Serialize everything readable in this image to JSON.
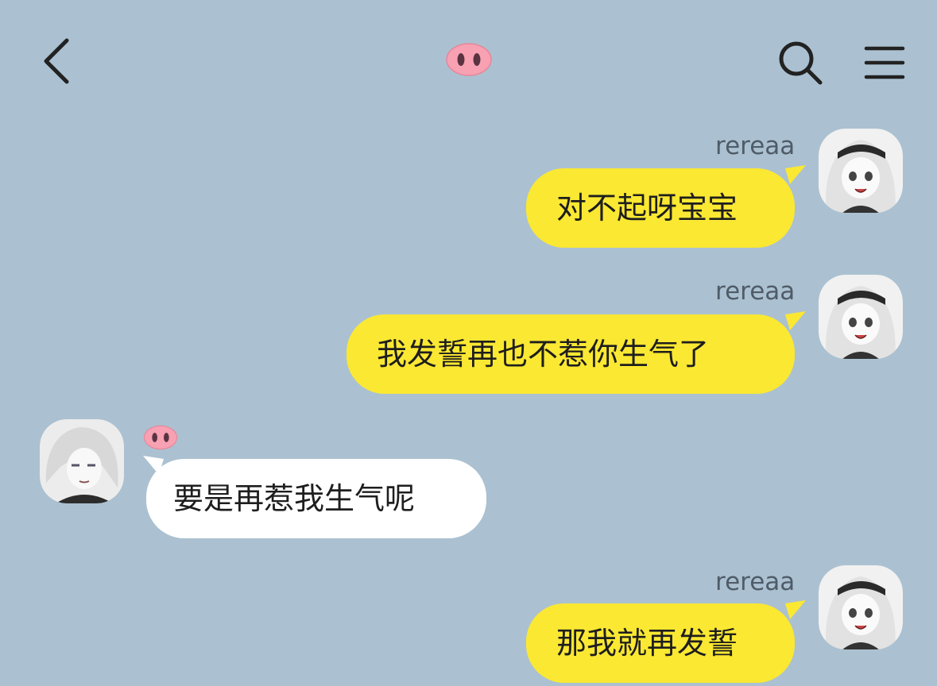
{
  "header": {
    "title_icon": "pig-nose-icon",
    "back_icon": "chevron-left-icon",
    "search_icon": "search-icon",
    "menu_icon": "hamburger-menu-icon"
  },
  "colors": {
    "background": "#abc1d1",
    "my_bubble": "#fbe832",
    "their_bubble": "#ffffff"
  },
  "messages": [
    {
      "sender": "rereaa",
      "text": "对不起呀宝宝",
      "from": "me"
    },
    {
      "sender": "rereaa",
      "text": "我发誓再也不惹你生气了",
      "from": "me"
    },
    {
      "sender_icon": "pig-nose-icon",
      "text": "要是再惹我生气呢",
      "from": "them"
    },
    {
      "sender": "rereaa",
      "text": "那我就再发誓",
      "from": "me"
    }
  ]
}
